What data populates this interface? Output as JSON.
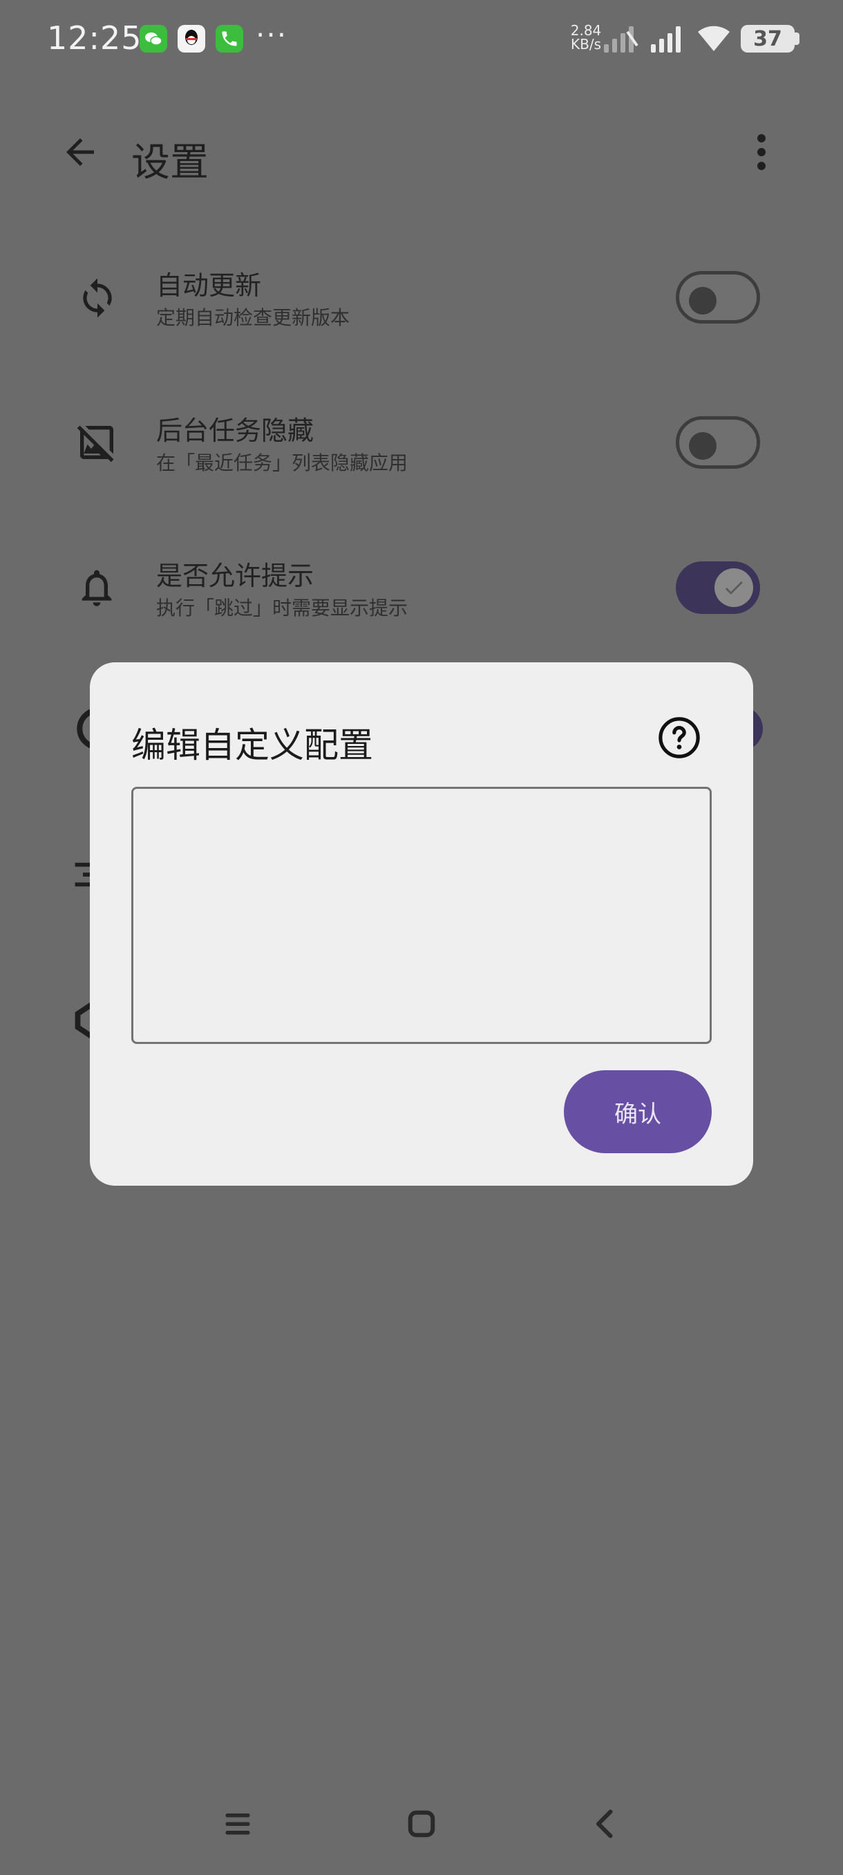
{
  "status_bar": {
    "time": "12:25",
    "net_speed_value": "2.84",
    "net_speed_unit": "KB/s",
    "battery": "37",
    "more": "···",
    "notification_icons": [
      "wechat-icon",
      "qq-icon",
      "phone-icon"
    ]
  },
  "app_bar": {
    "title": "设置"
  },
  "settings": [
    {
      "title": "自动更新",
      "subtitle": "定期自动检查更新版本",
      "icon": "sync-icon",
      "toggle": false
    },
    {
      "title": "后台任务隐藏",
      "subtitle": "在「最近任务」列表隐藏应用",
      "icon": "hide-image-icon",
      "toggle": false
    },
    {
      "title": "是否允许提示",
      "subtitle": "执行「跳过」时需要显示提示",
      "icon": "bell-icon",
      "toggle": true
    }
  ],
  "dialog": {
    "title": "编辑自定义配置",
    "input_value": "",
    "confirm_label": "确认"
  },
  "colors": {
    "scrim": "#6b6b6b",
    "dialog_bg": "#efefef",
    "accent": "#6750a4",
    "toggle_on": "#3d3459"
  }
}
